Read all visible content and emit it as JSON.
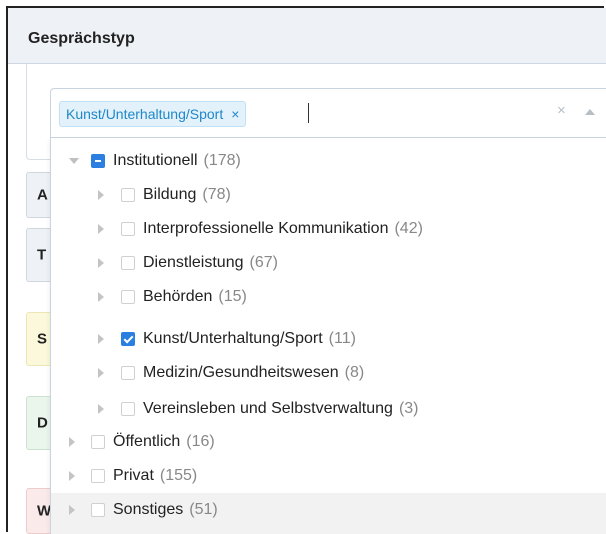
{
  "panel": {
    "title": "Gesprächstyp"
  },
  "background_tabs": [
    "A",
    "T",
    "S",
    "D",
    "W"
  ],
  "colors": {
    "accent": "#2a7fe0",
    "tag_text": "#1f88c9",
    "tag_bg": "#e3f1fb",
    "header_bg": "#eef2f6"
  },
  "select": {
    "selected_tag": "Kunst/Unterhaltung/Sport",
    "tag_remove_icon": "×",
    "clear_icon": "×"
  },
  "tree": {
    "institutionell": {
      "label": "Institutionell",
      "count": "(178)",
      "state": "partial",
      "expanded": true
    },
    "children": [
      {
        "label": "Bildung",
        "count": "(78)",
        "checked": false
      },
      {
        "label": "Interprofessionelle Kommunikation",
        "count": "(42)",
        "checked": false
      },
      {
        "label": "Dienstleistung",
        "count": "(67)",
        "checked": false
      },
      {
        "label": "Behörden",
        "count": "(15)",
        "checked": false
      },
      {
        "label": "Kunst/Unterhaltung/Sport",
        "count": "(11)",
        "checked": true
      },
      {
        "label": "Medizin/Gesundheitswesen",
        "count": "(8)",
        "checked": false
      },
      {
        "label": "Vereinsleben und Selbstverwaltung",
        "count": "(3)",
        "checked": false
      }
    ],
    "top_level": [
      {
        "label": "Öffentlich",
        "count": "(16)",
        "checked": false
      },
      {
        "label": "Privat",
        "count": "(155)",
        "checked": false
      },
      {
        "label": "Sonstiges",
        "count": "(51)",
        "checked": false
      }
    ]
  }
}
